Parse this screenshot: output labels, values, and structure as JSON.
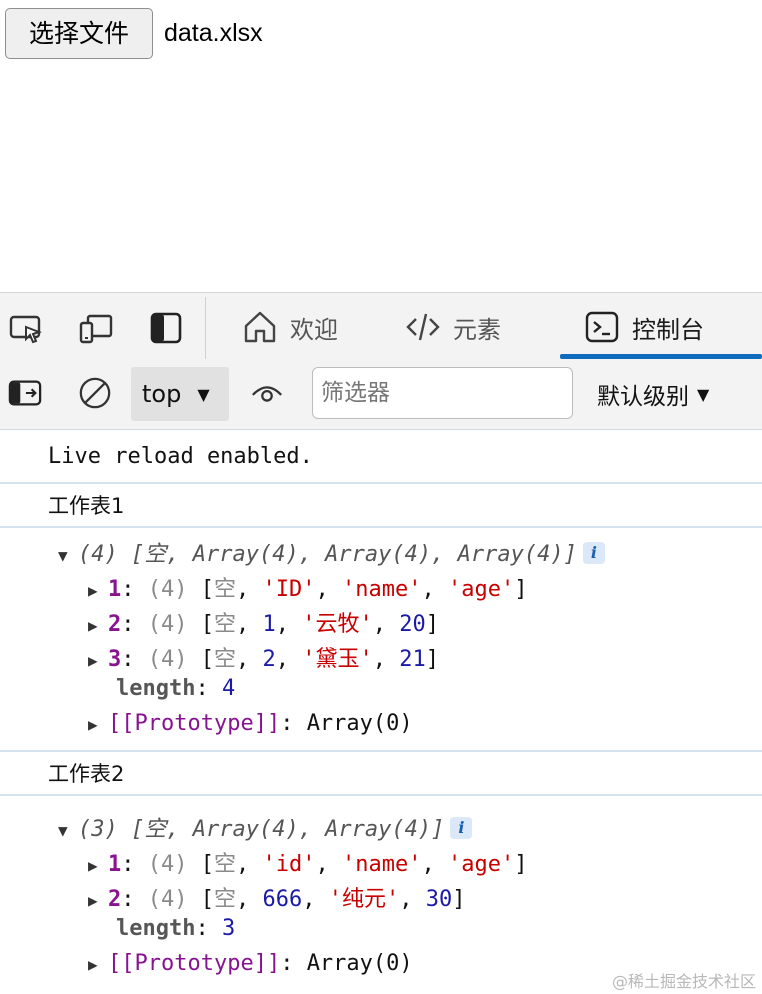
{
  "page": {
    "file_button_label": "选择文件",
    "file_name": "data.xlsx"
  },
  "devtools": {
    "tabs": [
      {
        "label": "欢迎",
        "icon": "home-icon"
      },
      {
        "label": "元素",
        "icon": "code-icon"
      },
      {
        "label": "控制台",
        "icon": "console-icon",
        "active": true
      }
    ],
    "toolbar": {
      "context_value": "top",
      "filter_placeholder": "筛选器",
      "level_label": "默认级别"
    },
    "accent_color": "#0f6cbd"
  },
  "console": {
    "live_reload": "Live reload enabled.",
    "sheets": [
      {
        "title": "工作表1",
        "summary_count": "(4)",
        "summary": "[空, Array(4), Array(4), Array(4)]",
        "rows": [
          {
            "index": "1",
            "count": "(4)",
            "items": [
              {
                "t": "grey",
                "v": "空"
              },
              {
                "t": "str",
                "v": "'ID'"
              },
              {
                "t": "str",
                "v": "'name'"
              },
              {
                "t": "str",
                "v": "'age'"
              }
            ]
          },
          {
            "index": "2",
            "count": "(4)",
            "items": [
              {
                "t": "grey",
                "v": "空"
              },
              {
                "t": "num",
                "v": "1"
              },
              {
                "t": "str",
                "v": "'云牧'"
              },
              {
                "t": "num",
                "v": "20"
              }
            ]
          },
          {
            "index": "3",
            "count": "(4)",
            "items": [
              {
                "t": "grey",
                "v": "空"
              },
              {
                "t": "num",
                "v": "2"
              },
              {
                "t": "str",
                "v": "'黛玉'"
              },
              {
                "t": "num",
                "v": "21"
              }
            ]
          }
        ],
        "length_label": "length",
        "length_value": "4",
        "prototype_label": "[[Prototype]]",
        "prototype_value": "Array(0)"
      },
      {
        "title": "工作表2",
        "summary_count": "(3)",
        "summary": "[空, Array(4), Array(4)]",
        "rows": [
          {
            "index": "1",
            "count": "(4)",
            "items": [
              {
                "t": "grey",
                "v": "空"
              },
              {
                "t": "str",
                "v": "'id'"
              },
              {
                "t": "str",
                "v": "'name'"
              },
              {
                "t": "str",
                "v": "'age'"
              }
            ]
          },
          {
            "index": "2",
            "count": "(4)",
            "items": [
              {
                "t": "grey",
                "v": "空"
              },
              {
                "t": "num",
                "v": "666"
              },
              {
                "t": "str",
                "v": "'纯元'"
              },
              {
                "t": "num",
                "v": "30"
              }
            ]
          }
        ],
        "length_label": "length",
        "length_value": "3",
        "prototype_label": "[[Prototype]]",
        "prototype_value": "Array(0)"
      }
    ]
  },
  "watermark": "@稀土掘金技术社区"
}
